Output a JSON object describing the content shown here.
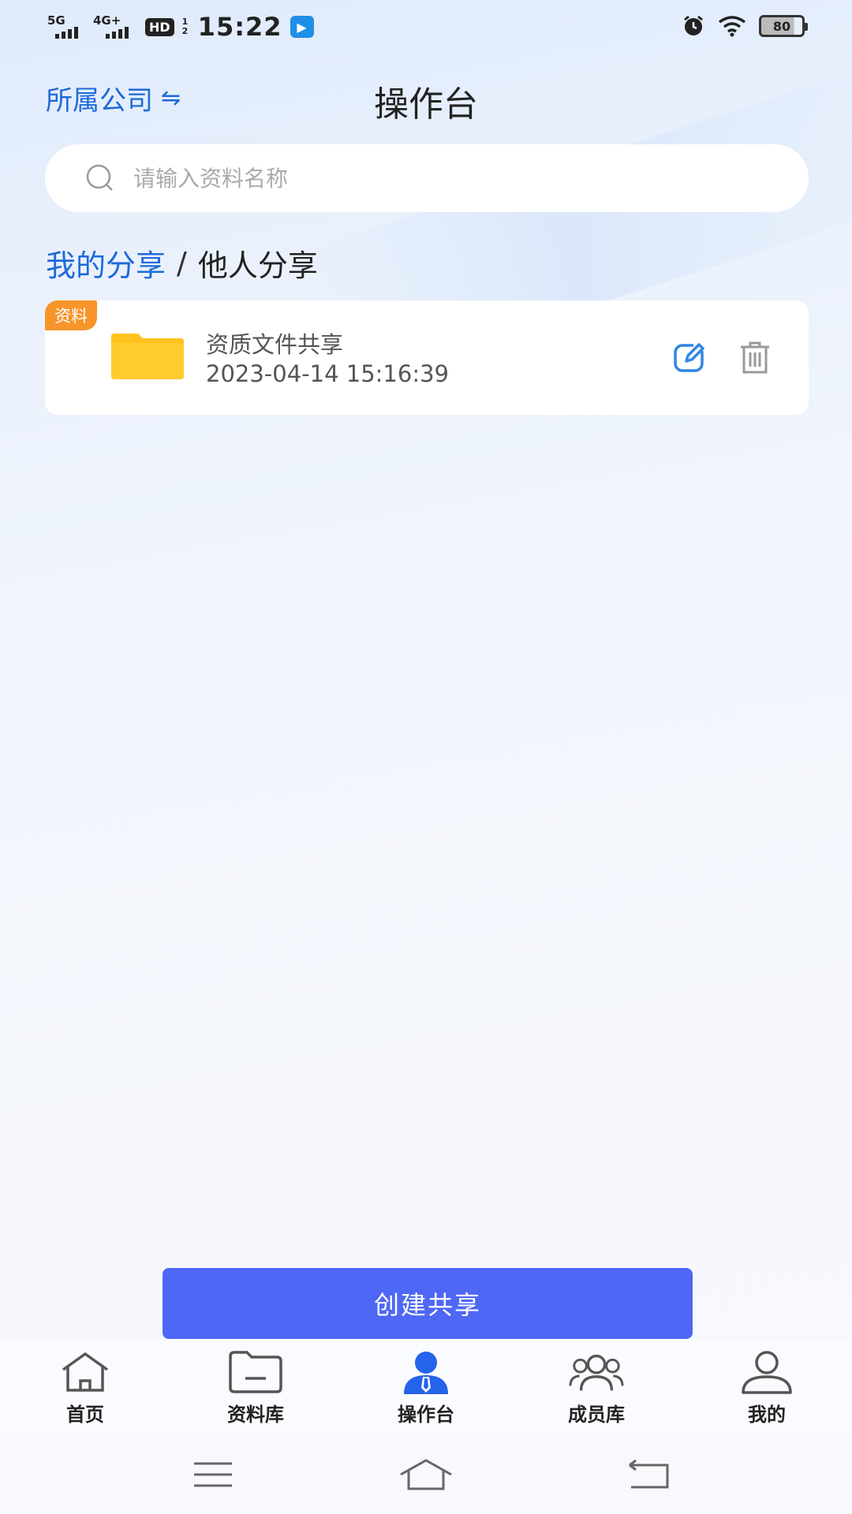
{
  "status_bar": {
    "network_1": "5G",
    "network_2": "4G+",
    "hd_label": "HD",
    "hd_sub": "1 2",
    "time": "15:22",
    "battery": "80"
  },
  "header": {
    "company_label": "所属公司",
    "company_swap_icon": "⇋",
    "title": "操作台"
  },
  "search": {
    "placeholder": "请输入资料名称",
    "value": ""
  },
  "tabs": {
    "mine": "我的分享",
    "separator": "/",
    "others": "他人分享"
  },
  "shares": [
    {
      "tag": "资料",
      "name": "资质文件共享",
      "time": "2023-04-14 15:16:39"
    }
  ],
  "actions": {
    "create_label": "创建共享"
  },
  "tabbar": {
    "items": [
      {
        "label": "首页",
        "icon": "home-icon"
      },
      {
        "label": "资料库",
        "icon": "folder-icon"
      },
      {
        "label": "操作台",
        "icon": "user-tie-icon",
        "active": true
      },
      {
        "label": "成员库",
        "icon": "group-icon"
      },
      {
        "label": "我的",
        "icon": "profile-icon"
      }
    ]
  },
  "colors": {
    "accent": "#1e6ad8",
    "button": "#4e67f5",
    "tag": "#f7952b",
    "folder": "#ffc21f"
  }
}
